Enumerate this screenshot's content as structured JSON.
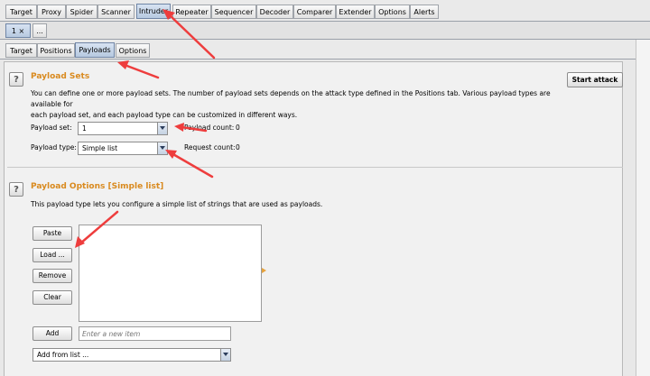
{
  "tool_tabs": [
    "Target",
    "Proxy",
    "Spider",
    "Scanner",
    "Intruder",
    "Repeater",
    "Sequencer",
    "Decoder",
    "Comparer",
    "Extender",
    "Options",
    "Alerts"
  ],
  "attack_tabs": [
    "1 ×",
    "..."
  ],
  "sub_tabs": [
    "Target",
    "Positions",
    "Payloads",
    "Options"
  ],
  "payload_sets": {
    "help": "?",
    "title": "Payload Sets",
    "description_line1": "You can define one or more payload sets. The number of payload sets depends on the attack type defined in the Positions tab. Various payload types are available for",
    "description_line2": "each payload set, and each payload type can be customized in different ways.",
    "payload_set_label": "Payload set:",
    "payload_set_value": "1",
    "payload_type_label": "Payload type:",
    "payload_type_value": "Simple list",
    "payload_count_label": "Payload count:",
    "payload_count_value": "0",
    "request_count_label": "Request count:",
    "request_count_value": "0"
  },
  "start_attack": "Start attack",
  "payload_options": {
    "help": "?",
    "title": "Payload Options [Simple list]",
    "description": "This payload type lets you configure a simple list of strings that are used as payloads.",
    "paste": "Paste",
    "load": "Load ...",
    "remove": "Remove",
    "clear": "Clear",
    "add": "Add",
    "new_item_placeholder": "Enter a new item",
    "add_from_list": "Add from list ..."
  },
  "colors": {
    "heading": "#d98a1f",
    "annotation_arrow": "#ee3d3d",
    "active_tab": "#c4d3e8"
  }
}
